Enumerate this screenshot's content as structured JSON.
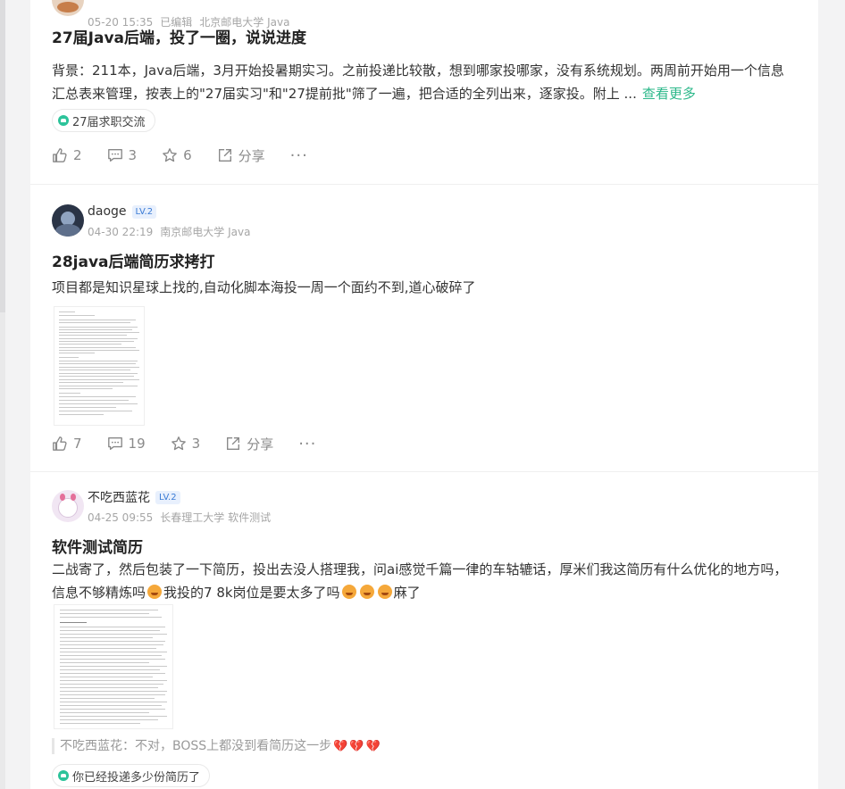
{
  "posts": [
    {
      "meta": {
        "time": "05-20 15:35",
        "edited": "已编辑",
        "school": "北京邮电大学 Java"
      },
      "title": "27届Java后端，投了一圈，说说进度",
      "body": "背景：211本，Java后端，3月开始投暑期实习。之前投递比较散，想到哪家投哪家，没有系统规划。两周前开始用一个信息汇总表来管理，按表上的\"27届实习\"和\"27提前批\"筛了一遍，把合适的全列出来，逐家投。附上 ...",
      "more": "查看更多",
      "tag": "27届求职交流",
      "actions": {
        "like": "2",
        "comment": "3",
        "star": "6",
        "share": "分享",
        "more": "···"
      }
    },
    {
      "user": {
        "name": "daoge",
        "level": "LV.2"
      },
      "meta": {
        "time": "04-30 22:19",
        "school": "南京邮电大学 Java"
      },
      "title": "28java后端简历求拷打",
      "body": "项目都是知识星球上找的,自动化脚本海投一周一个面约不到,道心破碎了",
      "actions": {
        "like": "7",
        "comment": "19",
        "star": "3",
        "share": "分享",
        "more": "···"
      }
    },
    {
      "user": {
        "name": "不吃西蓝花",
        "level": "LV.2"
      },
      "meta": {
        "time": "04-25 09:55",
        "school": "长春理工大学 软件测试"
      },
      "title": "软件测试简历",
      "body_part1": "二战寄了，然后包装了一下简历，投出去没人搭理我，问ai感觉千篇一律的车轱辘话，厚米们我这简历有什么优化的地方吗，信息不够精炼吗",
      "body_part2": "我投的7 8k岗位是要太多了吗",
      "body_part3": "麻了",
      "comment": {
        "author": "不吃西蓝花",
        "text": "不对，BOSS上都没到看简历这一步"
      },
      "tag": "你已经投递多少份简历了"
    }
  ]
}
